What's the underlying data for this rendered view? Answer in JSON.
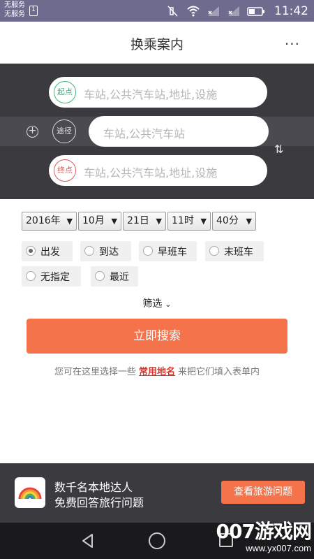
{
  "status_bar": {
    "carrier_line1": "无服务",
    "carrier_line2": "无服务",
    "sim_icon_label": "1",
    "time": "11:42",
    "icons": [
      "mute-icon",
      "wifi-icon",
      "signal-x-icon",
      "signal-x-icon",
      "battery-icon"
    ]
  },
  "header": {
    "title": "换乘案内",
    "more_label": "···"
  },
  "route_form": {
    "from_badge": "起点",
    "from_placeholder": "车站,公共汽车站,地址,设施",
    "via_badge": "途径",
    "via_placeholder": "车站,公共汽车站",
    "to_badge": "终点",
    "to_placeholder": "车站,公共汽车站,地址,设施",
    "add_via_symbol": "+",
    "swap_symbol": "⇅"
  },
  "datetime": {
    "year": "2016年",
    "month": "10月",
    "day": "21日",
    "hour": "11时",
    "minute": "40分",
    "arrow": "▼"
  },
  "time_mode": {
    "selected": "出发",
    "options": [
      {
        "label": "出发",
        "selected": true
      },
      {
        "label": "到达",
        "selected": false
      },
      {
        "label": "早班车",
        "selected": false
      },
      {
        "label": "末班车",
        "selected": false
      },
      {
        "label": "无指定",
        "selected": false
      },
      {
        "label": "最近",
        "selected": false
      }
    ]
  },
  "filter": {
    "label": "筛选",
    "chevron": "⌄"
  },
  "search_button": {
    "label": "立即搜索"
  },
  "hint": {
    "prefix": "您可在这里选择一些",
    "link": "常用地名",
    "suffix": "来把它们填入表单内"
  },
  "banner": {
    "line1": "数千名本地达人",
    "line2": "免费回答旅行问题",
    "button_label": "查看旅游问题",
    "logo_icon": "rainbow-icon"
  },
  "watermark": {
    "big": "007游戏网",
    "small": "www.yx007.com"
  },
  "colors": {
    "accent": "#f5734a",
    "panel": "#3a3a3f",
    "status_bar": "#6f6b8f",
    "from_green": "#3cb878",
    "to_red": "#e05a5a",
    "link_red": "#d9342b"
  }
}
